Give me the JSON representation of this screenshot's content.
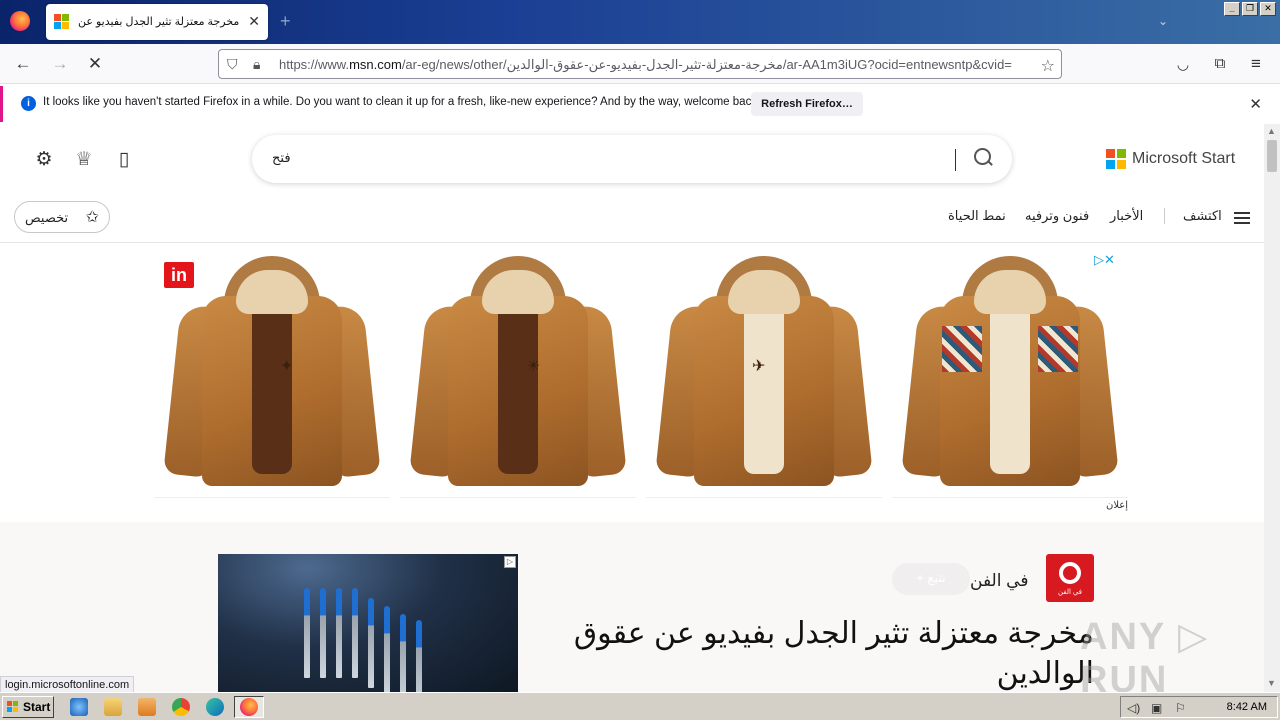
{
  "browser": {
    "tab_title": "مخرجة معتزلة تثير الجدل بفيديو عن",
    "tab_close": "✕",
    "new_tab": "+",
    "url_prefix": "https://www.",
    "url_host": "msn.com",
    "url_rest": "/ar-eg/news/other/مخرجة-معتزلة-تثير-الجدل-بفيديو-عن-عقوق-الوالدين/ar-AA1m3iUG?ocid=entnewsntp&cvid=",
    "window_buttons": [
      "_",
      "❐",
      "✕"
    ]
  },
  "notification": {
    "message": "It looks like you haven't started Firefox in a while. Do you want to clean it up for a fresh, like-new experience? And by the way, welcome back!",
    "button": "Refresh Firefox…",
    "info_icon": "i"
  },
  "msn": {
    "search_value": "فتح",
    "brand": "Microsoft Start",
    "personalize": "تخصيص",
    "nav_items": [
      {
        "label": "اكتشف"
      },
      {
        "label": "الأخبار"
      },
      {
        "label": "فنون وترفيه"
      },
      {
        "label": "نمط الحياة"
      }
    ]
  },
  "ad": {
    "ad_label": "إعلان",
    "ad_choice": "▷✕",
    "brand_badge": "in"
  },
  "article": {
    "publisher": "في الفن",
    "publisher_logo_text": "في الفن",
    "follow": "+ تتبع",
    "headline": "مخرجة معتزلة تثير الجدل بفيديو عن عقوق الوالدين"
  },
  "watermark": "ANY ▷ RUN",
  "status_url": "login.microsoftonline.com",
  "taskbar": {
    "start": "Start",
    "clock": "8:42 AM"
  },
  "colors": {
    "accent": "#0060df",
    "notice_border": "#e0158c",
    "publisher_red": "#d71920"
  }
}
